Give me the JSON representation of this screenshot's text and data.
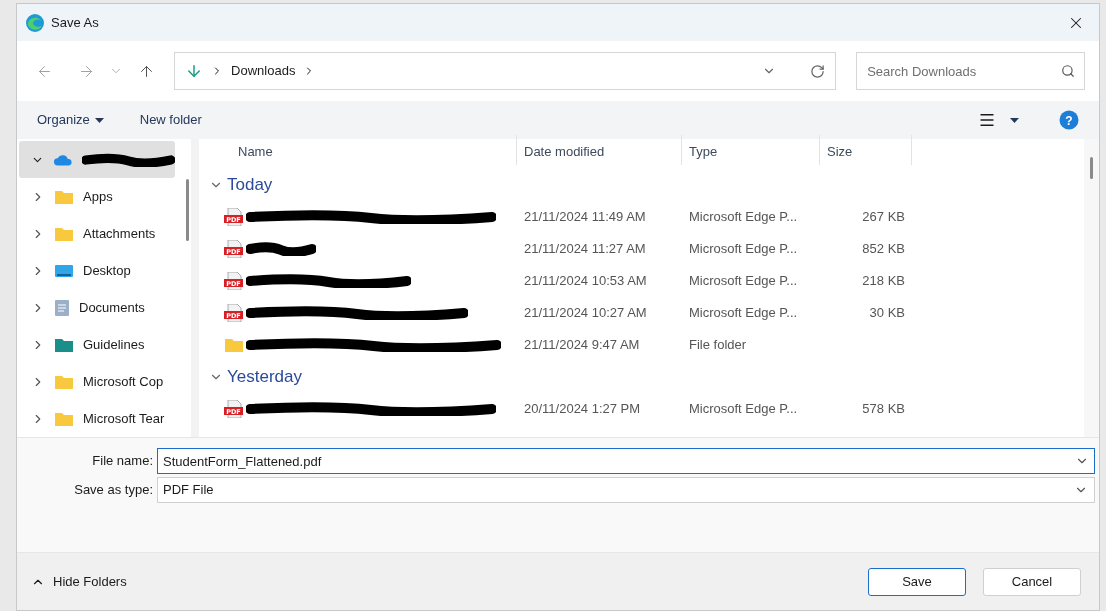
{
  "window": {
    "title": "Save As"
  },
  "address": {
    "location": "Downloads"
  },
  "search": {
    "placeholder": "Search Downloads"
  },
  "toolbar": {
    "organize": "Organize",
    "new_folder": "New folder",
    "help": "?"
  },
  "sidebar": {
    "items": [
      {
        "kind": "cloud",
        "redacted": true,
        "expanded": true,
        "selected": true
      },
      {
        "label": "Apps",
        "kind": "folder",
        "redacted": false,
        "expanded": false,
        "selected": false
      },
      {
        "label": "Attachments",
        "kind": "folder",
        "redacted": false,
        "expanded": false,
        "selected": false
      },
      {
        "label": "Desktop",
        "kind": "desktop",
        "redacted": false,
        "expanded": false,
        "selected": false
      },
      {
        "label": "Documents",
        "kind": "documents",
        "redacted": false,
        "expanded": false,
        "selected": false
      },
      {
        "label": "Guidelines",
        "kind": "teal-folder",
        "redacted": false,
        "expanded": false,
        "selected": false
      },
      {
        "label": "Microsoft Cop",
        "kind": "folder",
        "redacted": false,
        "expanded": false,
        "selected": false
      },
      {
        "label": "Microsoft Tear",
        "kind": "folder",
        "redacted": false,
        "expanded": false,
        "selected": false
      }
    ]
  },
  "table": {
    "columns": [
      "Name",
      "Date modified",
      "Type",
      "Size"
    ],
    "groups": [
      {
        "label": "Today",
        "expanded": true,
        "rows": [
          {
            "kind": "pdf",
            "icon_label": "PDF",
            "date": "21/11/2024 11:49 AM",
            "type": "Microsoft Edge P...",
            "size": "267 KB"
          },
          {
            "kind": "pdf",
            "icon_label": "PDF",
            "date": "21/11/2024 11:27 AM",
            "type": "Microsoft Edge P...",
            "size": "852 KB"
          },
          {
            "kind": "pdf",
            "icon_label": "PDF",
            "date": "21/11/2024 10:53 AM",
            "type": "Microsoft Edge P...",
            "size": "218 KB"
          },
          {
            "kind": "pdf",
            "icon_label": "PDF",
            "date": "21/11/2024 10:27 AM",
            "type": "Microsoft Edge P...",
            "size": "30 KB"
          },
          {
            "kind": "folder",
            "date": "21/11/2024 9:47 AM",
            "type": "File folder"
          }
        ]
      },
      {
        "label": "Yesterday",
        "expanded": true,
        "rows": [
          {
            "kind": "pdf",
            "icon_label": "PDF",
            "date": "20/11/2024 1:27 PM",
            "type": "Microsoft Edge P...",
            "size": "578 KB"
          }
        ]
      }
    ]
  },
  "form": {
    "file_name_label": "File name:",
    "file_name": "StudentForm_Flattened.pdf",
    "file_name_focused": true,
    "type_label": "Save as type:",
    "type": "PDF File"
  },
  "footer": {
    "hide_folders": "Hide Folders",
    "save": "Save",
    "cancel": "Cancel"
  }
}
